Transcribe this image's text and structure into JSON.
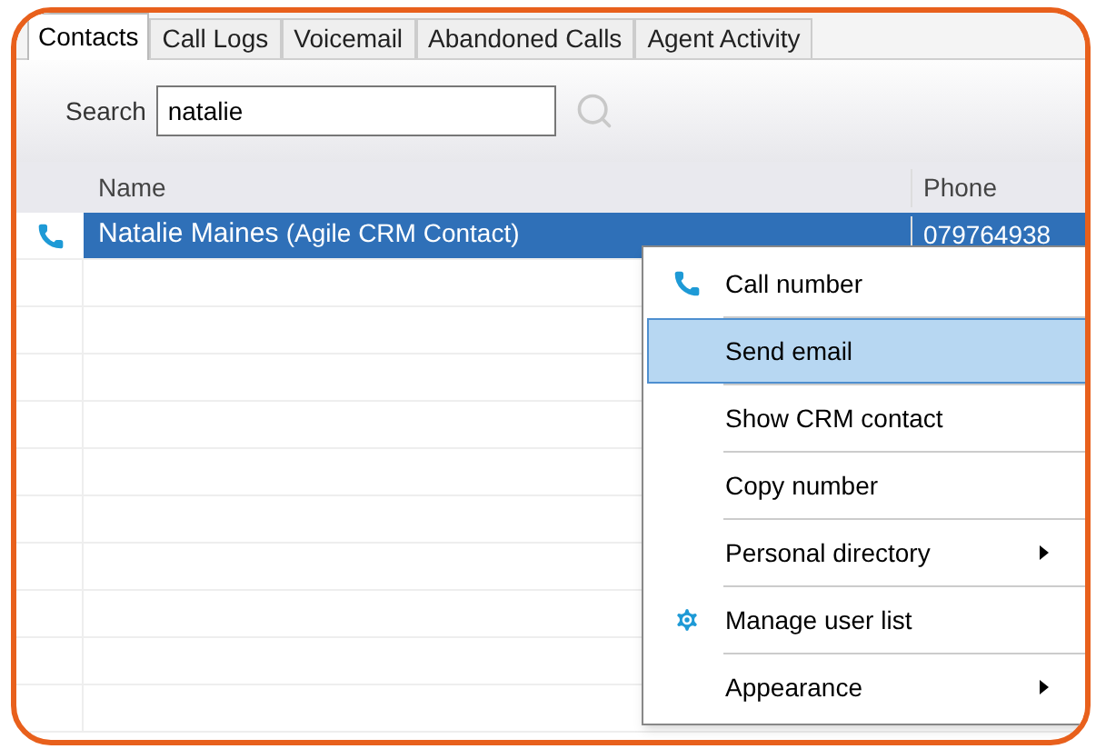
{
  "tabs": [
    {
      "label": "Contacts",
      "selected": true
    },
    {
      "label": "Call Logs",
      "selected": false
    },
    {
      "label": "Voicemail",
      "selected": false
    },
    {
      "label": "Abandoned Calls",
      "selected": false
    },
    {
      "label": "Agent Activity",
      "selected": false
    }
  ],
  "search": {
    "label": "Search",
    "value": "natalie"
  },
  "table": {
    "columns": [
      "Name",
      "Phone"
    ],
    "rows": [
      {
        "name": "Natalie Maines",
        "source": "(Agile CRM Contact)",
        "phone": "079764938",
        "selected": true
      }
    ]
  },
  "context_menu": [
    {
      "label": "Call number",
      "kind": "call",
      "selected": false
    },
    {
      "label": "Send email",
      "kind": "plain",
      "selected": true
    },
    {
      "label": "Show CRM contact",
      "kind": "plain",
      "selected": false
    },
    {
      "label": "Copy number",
      "kind": "plain",
      "selected": false
    },
    {
      "label": "Personal directory",
      "kind": "submenu",
      "selected": false
    },
    {
      "label": "Manage user list",
      "kind": "settings",
      "selected": false
    },
    {
      "label": "Appearance",
      "kind": "submenu",
      "selected": false
    }
  ]
}
